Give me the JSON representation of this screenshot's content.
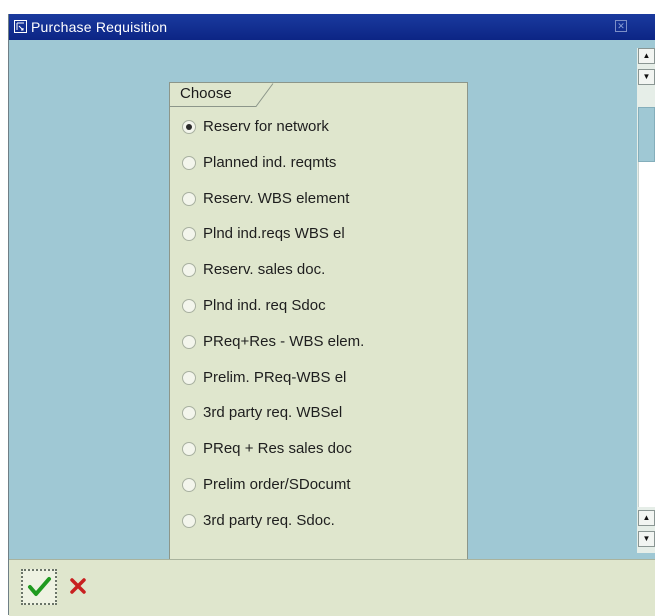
{
  "window": {
    "title": "Purchase Requisition"
  },
  "choose_group": {
    "label": "Choose",
    "selected_index": 0,
    "options": [
      "Reserv for network",
      "Planned ind. reqmts",
      "Reserv. WBS element",
      "Plnd ind.reqs WBS el",
      "Reserv. sales doc.",
      "Plnd ind. req Sdoc",
      "PReq+Res - WBS elem.",
      "Prelim. PReq-WBS el",
      "3rd party req. WBSel",
      "PReq + Res sales doc",
      "Prelim order/SDocumt",
      "3rd party req. Sdoc."
    ]
  },
  "footer": {
    "confirm_icon": "checkmark-icon",
    "cancel_icon": "cancel-x-icon"
  },
  "colors": {
    "titlebar": "#0c2585",
    "window_bg": "#9fc8d4",
    "panel_bg": "#dfe6cd",
    "confirm_green": "#1f9a1f",
    "cancel_red": "#c82020"
  }
}
